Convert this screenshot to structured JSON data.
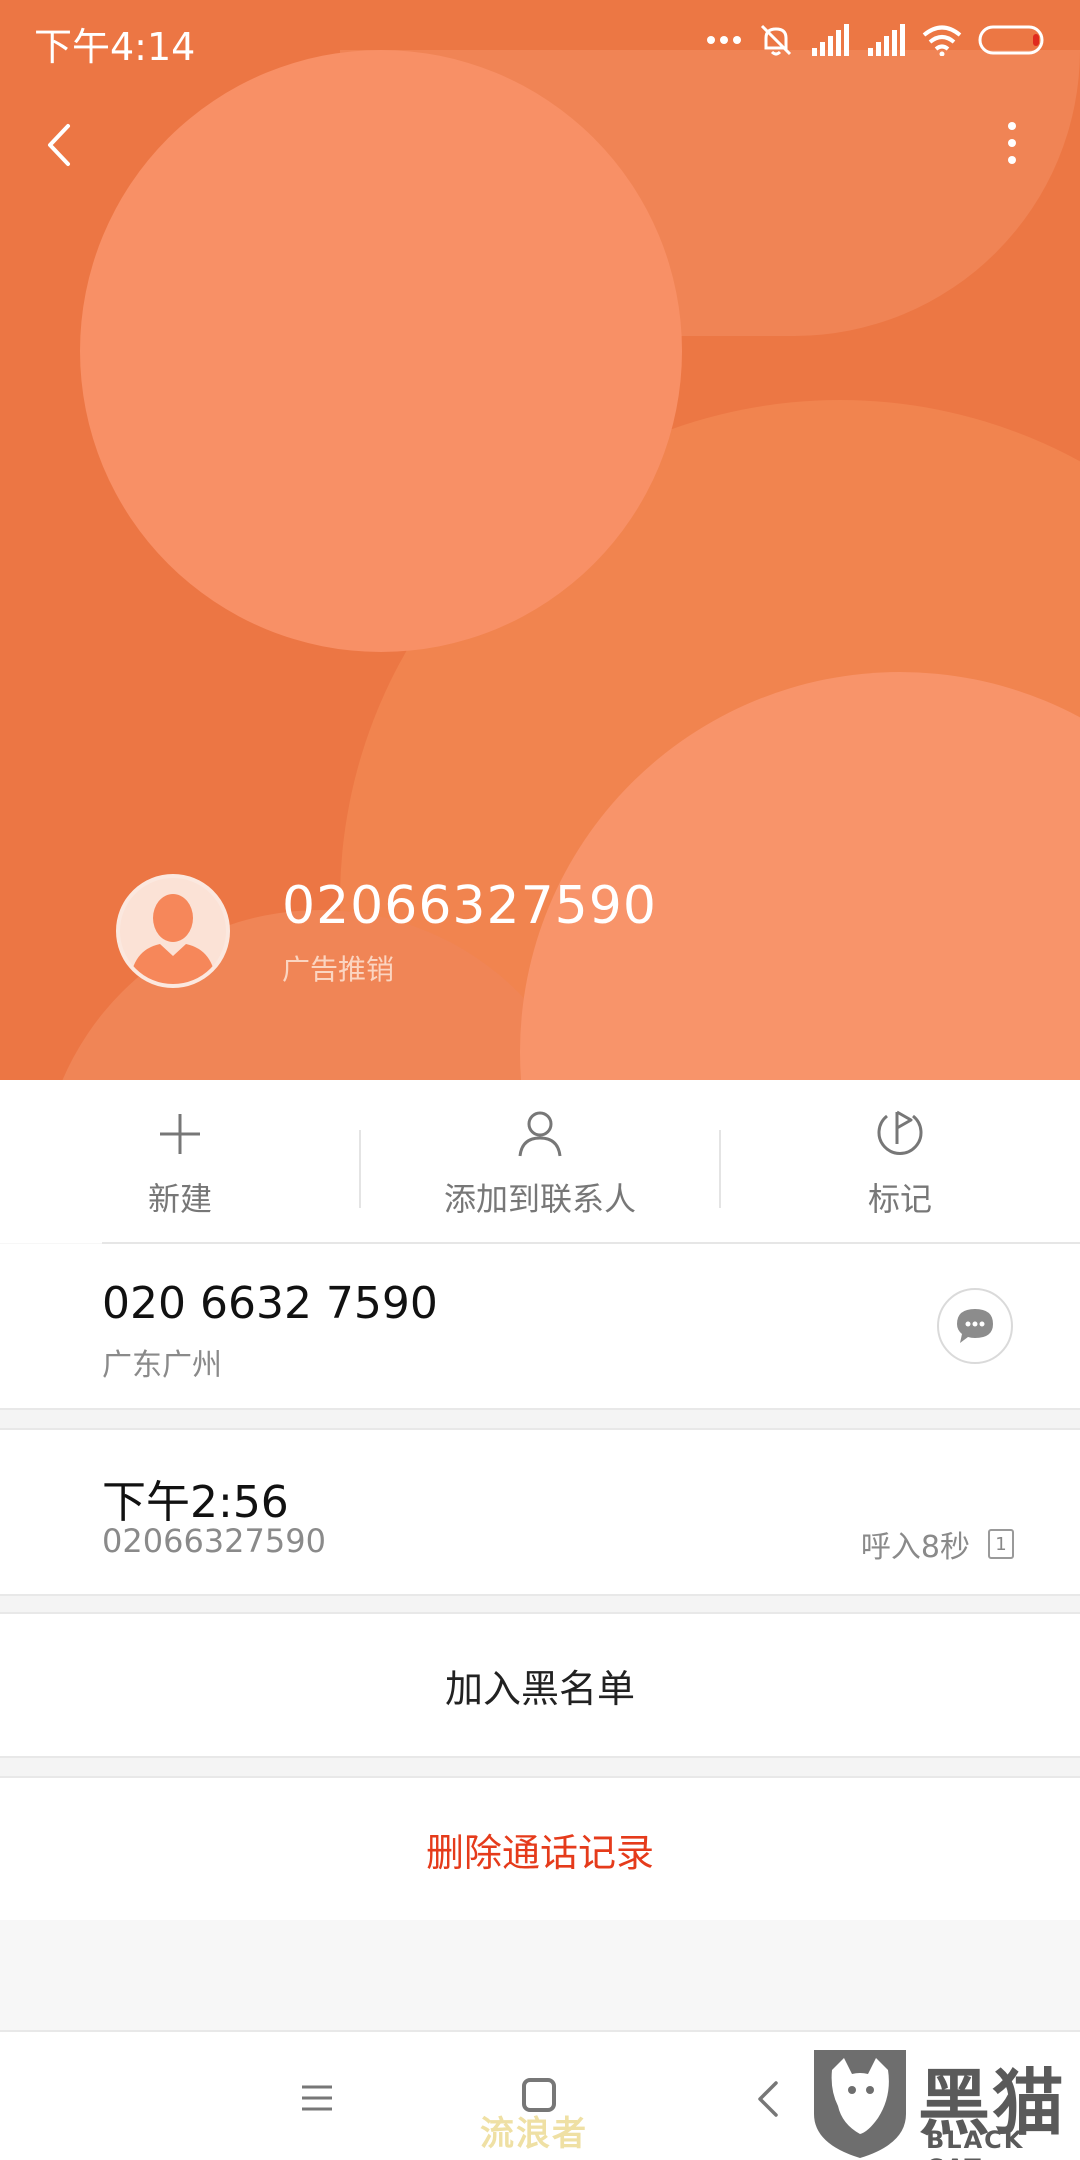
{
  "statusbar": {
    "time": "下午4:14"
  },
  "caller": {
    "number": "02066327590",
    "tag": "广告推销"
  },
  "actions": [
    {
      "label": "新建",
      "icon": "plus-icon"
    },
    {
      "label": "添加到联系人",
      "icon": "person-icon"
    },
    {
      "label": "标记",
      "icon": "flag-icon"
    }
  ],
  "number_detail": {
    "number": "020 6632 7590",
    "location": "广东广州"
  },
  "call_log": {
    "time": "下午2:56",
    "number": "02066327590",
    "info": "呼入8秒",
    "sim": "1"
  },
  "block_label": "加入黑名单",
  "delete_label": "删除通话记录",
  "watermark": {
    "text": "流浪者",
    "brand_cn": "黑猫",
    "brand_en": "BLACK CAT"
  },
  "colors": {
    "header": "#ec7744",
    "delete": "#e53b1b"
  }
}
